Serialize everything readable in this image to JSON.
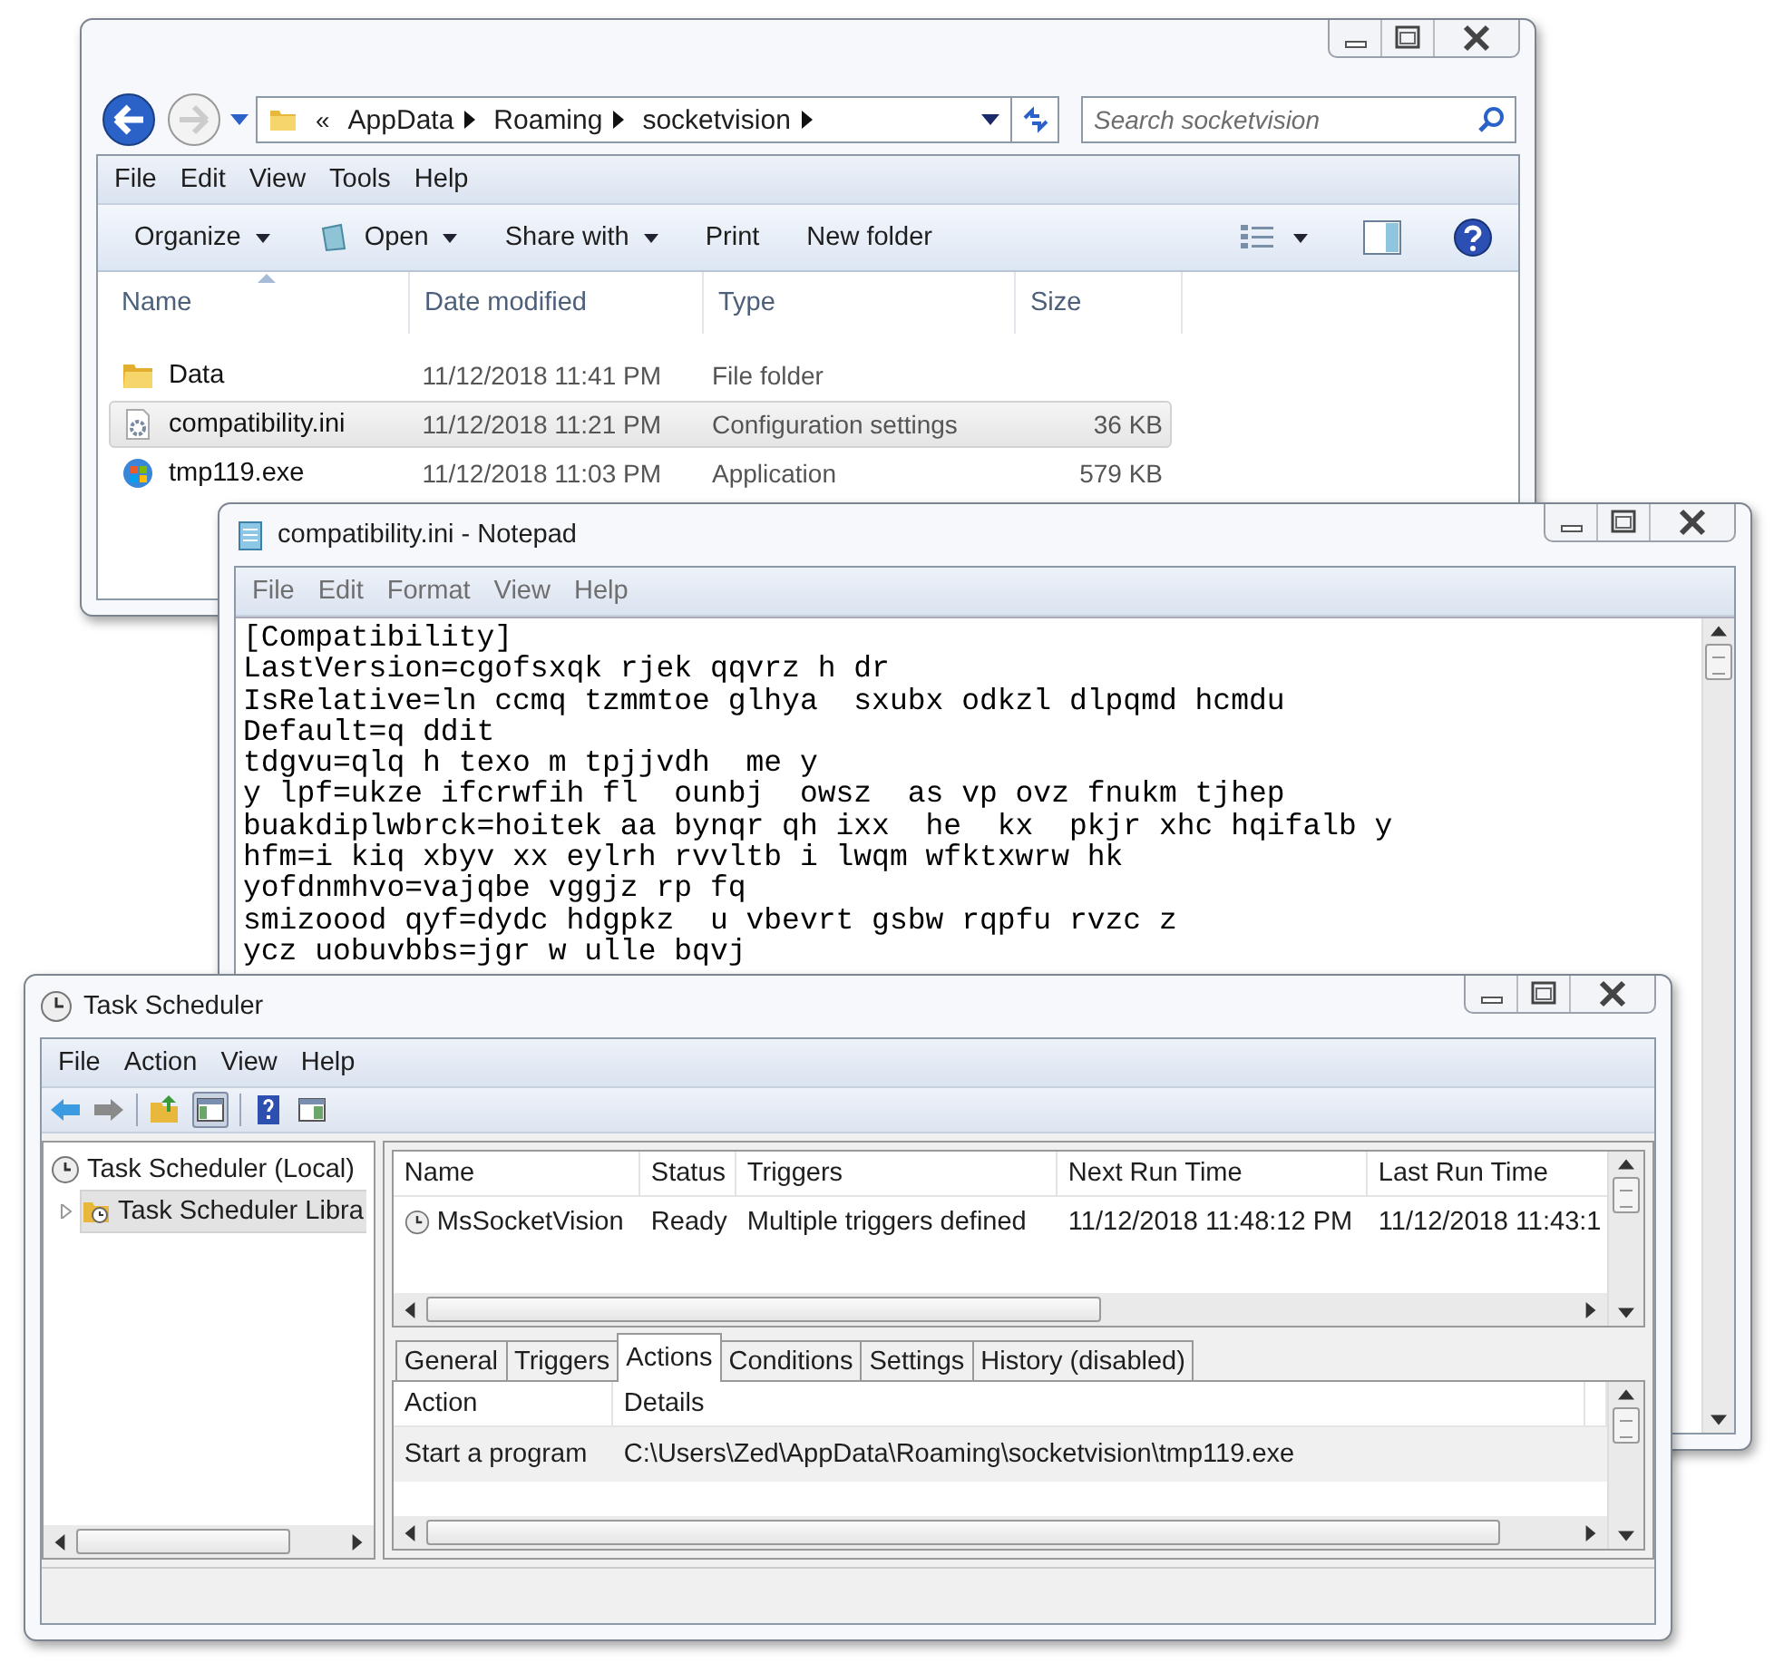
{
  "explorer": {
    "address": {
      "overflow": "«",
      "crumbs": [
        "AppData",
        "Roaming",
        "socketvision"
      ]
    },
    "search": {
      "placeholder": "Search socketvision"
    },
    "menu": [
      "File",
      "Edit",
      "View",
      "Tools",
      "Help"
    ],
    "toolbar": [
      {
        "label": "Organize",
        "kind": "menu"
      },
      {
        "label": "Open",
        "kind": "open"
      },
      {
        "label": "Share with",
        "kind": "menu"
      },
      {
        "label": "Print",
        "kind": "plain"
      },
      {
        "label": "New folder",
        "kind": "plain"
      }
    ],
    "columns": [
      "Name",
      "Date modified",
      "Type",
      "Size"
    ],
    "files": [
      {
        "kind": "folder",
        "name": "Data",
        "date": "11/12/2018 11:41 PM",
        "type": "File folder",
        "selected": false
      },
      {
        "kind": "settings",
        "name": "compatibility.ini",
        "date": "11/12/2018 11:21 PM",
        "type": "Configuration settings",
        "size": "36 KB",
        "selected": true
      },
      {
        "kind": "app",
        "name": "tmp119.exe",
        "date": "11/12/2018 11:03 PM",
        "type": "Application",
        "size": "579 KB",
        "selected": false
      }
    ]
  },
  "notepad": {
    "title": "compatibility.ini - Notepad",
    "menu": [
      "File",
      "Edit",
      "Format",
      "View",
      "Help"
    ],
    "lines": [
      "[Compatibility]",
      "LastVersion=cgofsxqk rjek qqvrz h dr",
      "IsRelative=ln ccmq tzmmtoe glhya  sxubx odkzl dlpqmd hcmdu",
      "Default=q ddit",
      "tdgvu=qlq h texo m tpjjvdh  me y",
      "y lpf=ukze ifcrwfih fl  ounbj  owsz  as vp ovz fnukm tjhep",
      "buakdiplwbrck=hoitek aa bynqr qh ixx  he  kx  pkjr xhc hqifalb y",
      "hfm=i kiq xbyv xx eylrh rvvltb i lwqm wfktxwrw hk",
      "yofdnmhvo=vajqbe vggjz rp fq",
      "smizoood qyf=dydc hdgpkz  u vbevrt gsbw rqpfu rvzc z",
      "ycz uobuvbbs=jgr w ulle bqvj"
    ]
  },
  "scheduler": {
    "title": "Task Scheduler",
    "menu": [
      "File",
      "Action",
      "View",
      "Help"
    ],
    "tree": [
      {
        "label": "Task Scheduler (Local)",
        "selected": false,
        "children": [
          {
            "label": "Task Scheduler Libra",
            "selected": true,
            "expanded": false
          }
        ]
      }
    ],
    "task_columns": [
      "Name",
      "Status",
      "Triggers",
      "Next Run Time",
      "Last Run Time"
    ],
    "tasks": [
      {
        "name": "MsSocketVision",
        "status": "Ready",
        "triggers": "Multiple triggers defined",
        "next_run": "11/12/2018 11:48:12 PM",
        "last_run": "11/12/2018 11:43:1"
      }
    ],
    "tabs": [
      {
        "label": "General",
        "selected": false
      },
      {
        "label": "Triggers",
        "selected": false
      },
      {
        "label": "Actions",
        "selected": true
      },
      {
        "label": "Conditions",
        "selected": false
      },
      {
        "label": "Settings",
        "selected": false
      },
      {
        "label": "History (disabled)",
        "selected": false
      }
    ],
    "action_columns": [
      "Action",
      "Details"
    ],
    "actions": [
      {
        "action": "Start a program",
        "details": "C:\\Users\\Zed\\AppData\\Roaming\\socketvision\\tmp119.exe"
      }
    ]
  }
}
